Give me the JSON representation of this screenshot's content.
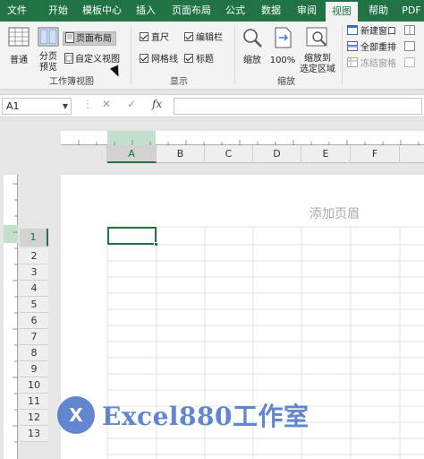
{
  "tabs": [
    "文件",
    "开始",
    "模板中心",
    "插入",
    "页面布局",
    "公式",
    "数据",
    "审阅",
    "视图",
    "帮助",
    "PDF"
  ],
  "active_tab": "视图",
  "ribbon": {
    "workbook_views": {
      "normal": "普通",
      "page_break": "分页\n预览",
      "page_layout": "页面布局",
      "custom_views": "自定义视图",
      "label": "工作簿视图"
    },
    "show": {
      "ruler": "直尺",
      "formula_bar": "编辑栏",
      "gridlines": "网格线",
      "headings": "标题",
      "label": "显示"
    },
    "zoom": {
      "zoom": "缩放",
      "zoom100": "100%",
      "zoom_selection": "缩放到\n选定区域",
      "label": "缩放"
    },
    "window": {
      "new_window": "新建窗口",
      "arrange_all": "全部重排",
      "freeze": "冻结窗格"
    }
  },
  "formula_bar": {
    "name_box": "A1",
    "cancel": "✕",
    "enter": "✓",
    "fx": "fx",
    "value": ""
  },
  "sheet": {
    "columns": [
      "A",
      "B",
      "C",
      "D",
      "E",
      "F"
    ],
    "rows": [
      "1",
      "2",
      "3",
      "4",
      "5",
      "6",
      "7",
      "8",
      "9",
      "10",
      "11",
      "12",
      "13"
    ],
    "header_placeholder": "添加页眉",
    "selected_cell": "A1"
  },
  "watermark": {
    "logo": "X",
    "text": "Excel880工作室"
  },
  "colors": {
    "accent": "#217346",
    "watermark": "#3b68c4"
  }
}
